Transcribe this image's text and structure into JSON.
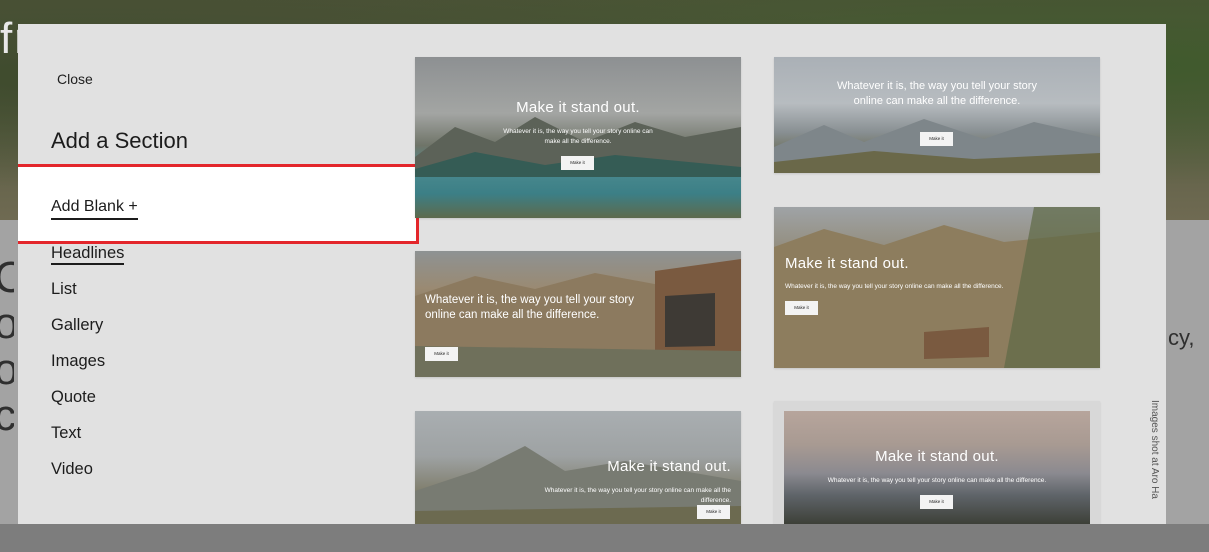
{
  "background": {
    "hero_text": "fr",
    "left_letters": [
      "C",
      "o",
      "o",
      "c"
    ],
    "right_text": "cy,"
  },
  "modal": {
    "close_label": "Close",
    "title": "Add a Section",
    "add_blank_label": "Add Blank +",
    "categories": [
      {
        "label": "Headlines",
        "active": true
      },
      {
        "label": "List",
        "active": false
      },
      {
        "label": "Gallery",
        "active": false
      },
      {
        "label": "Images",
        "active": false
      },
      {
        "label": "Quote",
        "active": false
      },
      {
        "label": "Text",
        "active": false
      },
      {
        "label": "Video",
        "active": false
      }
    ],
    "previews": [
      {
        "title": "Make it stand out.",
        "body": "Whatever it is, the way you tell your story online can make all the difference.",
        "button": "Make it"
      },
      {
        "title": "",
        "body": "Whatever it is, the way you tell your story online can make all the difference.",
        "button": "Make it"
      },
      {
        "title": "",
        "body": "Whatever it is, the way you tell your story online can make all the difference.",
        "button": "Make it"
      },
      {
        "title": "Make it stand out.",
        "body": "Whatever it is, the way you tell your story online can make all the difference.",
        "button": "Make it"
      },
      {
        "title": "Make it stand out.",
        "body": "Whatever it is, the way you tell your story online can make all the difference.",
        "button": "Make it"
      },
      {
        "title": "Make it stand out.",
        "body": "Whatever it is, the way you tell your story online can make all the difference.",
        "button": "Make it"
      }
    ],
    "credit": "Images shot at Aro Ha"
  },
  "colors": {
    "highlight": "#e3262b",
    "modal_bg": "#e1e1e1"
  }
}
